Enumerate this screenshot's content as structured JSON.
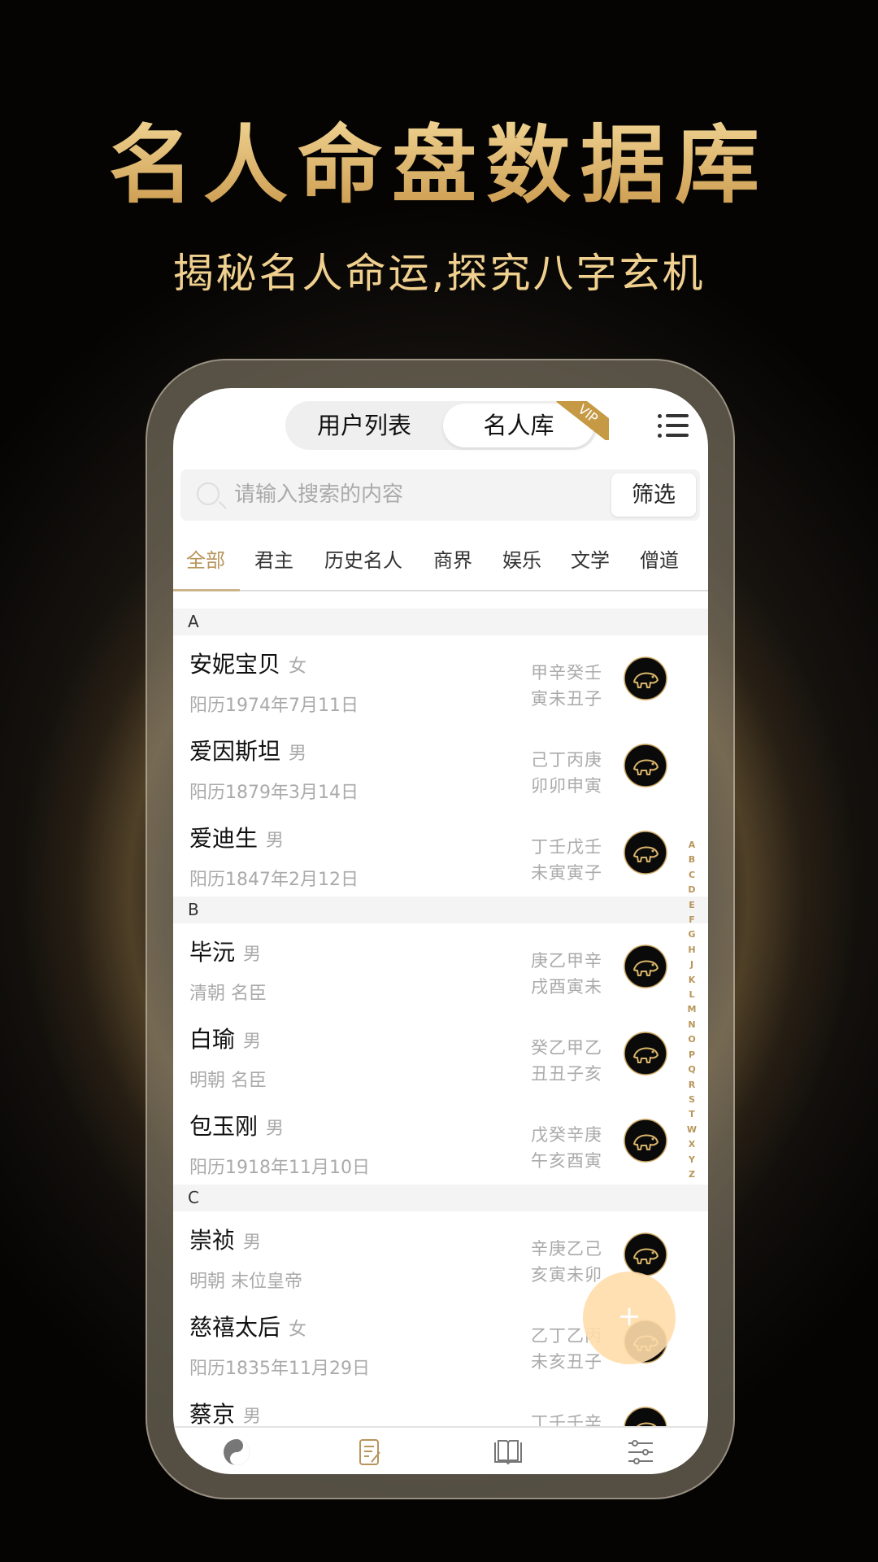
{
  "promo": {
    "title": "名人命盘数据库",
    "subtitle": "揭秘名人命运,探究八字玄机"
  },
  "header": {
    "segments": [
      "用户列表",
      "名人库"
    ],
    "active_segment": 1,
    "vip_badge": "VIP",
    "menu_icon": "list-menu-icon"
  },
  "search": {
    "placeholder": "请输入搜索的内容",
    "filter_label": "筛选"
  },
  "tabs": {
    "items": [
      "全部",
      "君主",
      "历史名人",
      "商界",
      "娱乐",
      "文学",
      "僧道"
    ],
    "active": 0
  },
  "colors": {
    "accent": "#b8955a",
    "fab": "#ffddaa",
    "vip": "#c69a45"
  },
  "sections": [
    {
      "letter": "A",
      "rows": [
        {
          "name": "安妮宝贝",
          "gender": "女",
          "sub": "阳历1974年7月11日",
          "bazi1": "甲辛癸壬",
          "bazi2": "寅未丑子",
          "zodiac": "tiger-icon"
        },
        {
          "name": "爱因斯坦",
          "gender": "男",
          "sub": "阳历1879年3月14日",
          "bazi1": "己丁丙庚",
          "bazi2": "卯卯申寅",
          "zodiac": "rabbit-icon"
        },
        {
          "name": "爱迪生",
          "gender": "男",
          "sub": "阳历1847年2月12日",
          "bazi1": "丁壬戊壬",
          "bazi2": "未寅寅子",
          "zodiac": "goat-icon"
        }
      ]
    },
    {
      "letter": "B",
      "rows": [
        {
          "name": "毕沅",
          "gender": "男",
          "sub": "清朝 名臣",
          "bazi1": "庚乙甲辛",
          "bazi2": "戌酉寅未",
          "zodiac": "dog-icon"
        },
        {
          "name": "白瑜",
          "gender": "男",
          "sub": "明朝 名臣",
          "bazi1": "癸乙甲乙",
          "bazi2": "丑丑子亥",
          "zodiac": "ox-icon"
        },
        {
          "name": "包玉刚",
          "gender": "男",
          "sub": "阳历1918年11月10日",
          "bazi1": "戊癸辛庚",
          "bazi2": "午亥酉寅",
          "zodiac": "horse-icon"
        }
      ]
    },
    {
      "letter": "C",
      "rows": [
        {
          "name": "崇祯",
          "gender": "男",
          "sub": "明朝 末位皇帝",
          "bazi1": "辛庚乙己",
          "bazi2": "亥寅未卯",
          "zodiac": "pig-icon"
        },
        {
          "name": "慈禧太后",
          "gender": "女",
          "sub": "阳历1835年11月29日",
          "bazi1": "乙丁乙丙",
          "bazi2": "未亥丑子",
          "zodiac": "goat-icon"
        },
        {
          "name": "蔡京",
          "gender": "男",
          "sub": "",
          "bazi1": "丁壬壬辛",
          "bazi2": "",
          "zodiac": "pig-icon"
        }
      ]
    }
  ],
  "index_letters": [
    "A",
    "B",
    "C",
    "D",
    "E",
    "F",
    "G",
    "H",
    "J",
    "K",
    "L",
    "M",
    "N",
    "O",
    "P",
    "Q",
    "R",
    "S",
    "T",
    "W",
    "X",
    "Y",
    "Z"
  ],
  "fab": {
    "label": "+"
  },
  "bottom_nav": [
    {
      "icon": "yin-yang-icon"
    },
    {
      "icon": "notes-icon"
    },
    {
      "icon": "book-icon"
    },
    {
      "icon": "settings-sliders-icon"
    }
  ]
}
